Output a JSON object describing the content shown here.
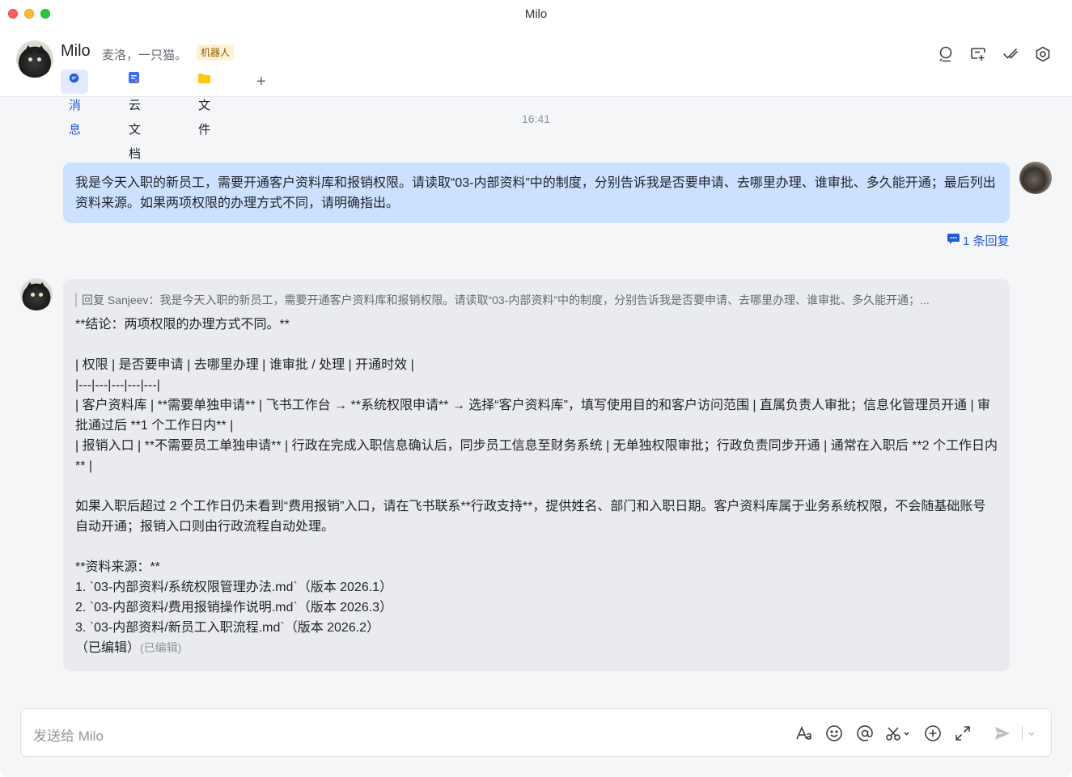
{
  "window": {
    "title": "Milo"
  },
  "header": {
    "name": "Milo",
    "description": "麦洛，一只猫。",
    "badge": "机器人",
    "tabs": [
      {
        "label": "消息",
        "icon": "message-icon",
        "active": true
      },
      {
        "label": "云文档",
        "icon": "cloud-doc-icon",
        "active": false
      },
      {
        "label": "文件",
        "icon": "folder-icon",
        "active": false
      },
      {
        "label": "+",
        "icon": "add-icon",
        "active": false
      }
    ],
    "actions": [
      "search-icon",
      "add-screen-icon",
      "checkmark-icon",
      "settings-icon"
    ]
  },
  "chat": {
    "timestamp": "16:41",
    "user_message": "我是今天入职的新员工，需要开通客户资料库和报销权限。请读取“03-内部资料”中的制度，分别告诉我是否要申请、去哪里办理、谁审批、多久能开通；最后列出资料来源。如果两项权限的办理方式不同，请明确指出。",
    "reply_count": "1 条回复",
    "bot_quote": "回复 Sanjeev：我是今天入职的新员工，需要开通客户资料库和报销权限。请读取“03-内部资料”中的制度，分别告诉我是否要申请、去哪里办理、谁审批、多久能开通；...",
    "bot_body": "**结论：两项权限的办理方式不同。**\n\n| 权限 | 是否要申请 | 去哪里办理 | 谁审批 / 处理 | 开通时效 |\n|---|---|---|---|---|\n| 客户资料库 | **需要单独申请** | 飞书工作台 → **系统权限申请** → 选择“客户资料库”，填写使用目的和客户访问范围 | 直属负责人审批；信息化管理员开通 | 审批通过后 **1 个工作日内** |\n| 报销入口 | **不需要员工单独申请** | 行政在完成入职信息确认后，同步员工信息至财务系统 | 无单独权限审批；行政负责同步开通 | 通常在入职后 **2 个工作日内** |\n\n如果入职后超过 2 个工作日仍未看到“费用报销”入口，请在飞书联系**行政支持**，提供姓名、部门和入职日期。客户资料库属于业务系统权限，不会随基础账号自动开通；报销入口则由行政流程自动处理。\n\n**资料来源：**\n1. `03-内部资料/系统权限管理办法.md`（版本 2026.1）\n2. `03-内部资料/费用报销操作说明.md`（版本 2026.3）\n3. `03-内部资料/新员工入职流程.md`（版本 2026.2）",
    "edited_text": "（已编辑）",
    "edited_tag": "(已编辑)"
  },
  "composer": {
    "placeholder": "发送给 Milo",
    "tools": [
      "font-format-icon",
      "emoji-icon",
      "mention-icon",
      "scissors-icon",
      "add-circle-icon",
      "expand-icon",
      "send-icon",
      "chevron-down-icon"
    ]
  },
  "colors": {
    "accent": "#245bdb",
    "user_bubble": "#cce0ff",
    "bot_bubble": "#eaebee",
    "badge_bg": "#fdf3d4",
    "badge_text": "#8f5a06"
  }
}
